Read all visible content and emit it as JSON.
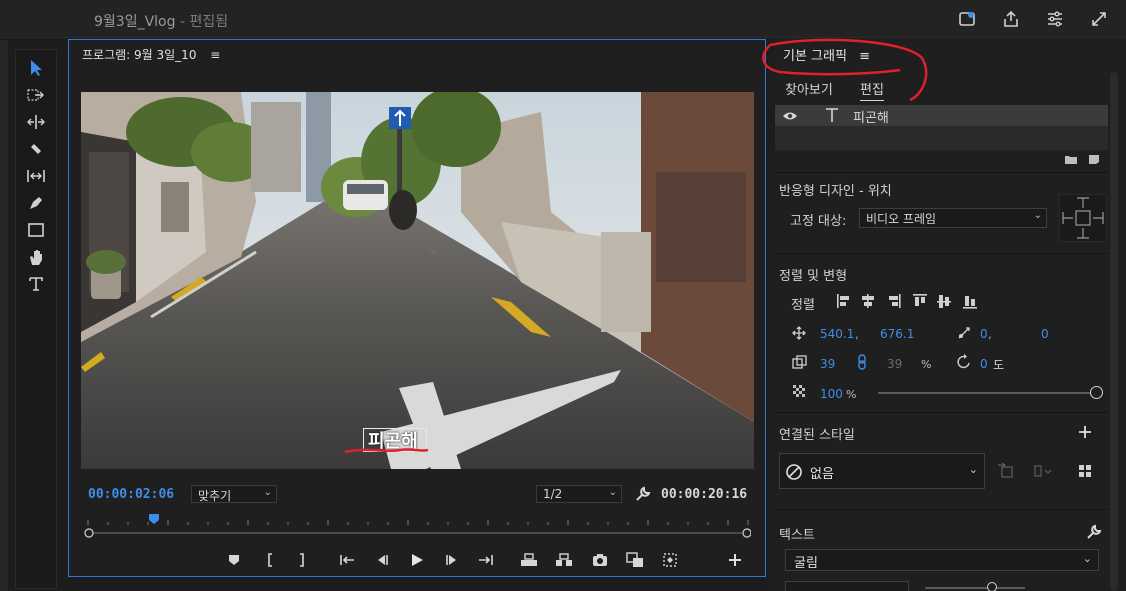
{
  "window": {
    "title": "9월3일_Vlog",
    "title_suffix": "- 편집됨"
  },
  "program": {
    "header": "프로그램: 9월 3일_10",
    "menu_glyph": "≡",
    "current_time": "00:00:02:06",
    "zoom_label": "맞추기",
    "resolution_label": "1/2",
    "duration": "00:00:20:16",
    "caption_text": "피곤해"
  },
  "essential_graphics": {
    "title": "기본 그래픽",
    "menu_glyph": "≡",
    "tabs": [
      "찾아보기",
      "편집"
    ],
    "active_tab": "편집",
    "layer_name": "피곤해",
    "responsive_design": {
      "heading": "반응형 디자인 - 위치",
      "pin_label": "고정 대상:",
      "pin_value": "비디오 프레임"
    },
    "align_transform": {
      "heading": "정렬 및 변형",
      "align_label": "정렬",
      "position_x": "540.1",
      "position_y": "676.1",
      "anchor_x": "0",
      "anchor_y": "0",
      "scale": "39",
      "scale_width": "39",
      "percent": "%",
      "rotation": "0",
      "rotation_unit": "도",
      "opacity": "100",
      "opacity_unit": "%"
    },
    "linked_style": {
      "heading": "연결된 스타일",
      "value": "없음"
    },
    "text": {
      "heading": "텍스트",
      "font": "굴림"
    }
  },
  "colors": {
    "accent_blue": "#3d8ee6",
    "annotation_red": "#e0202a"
  }
}
